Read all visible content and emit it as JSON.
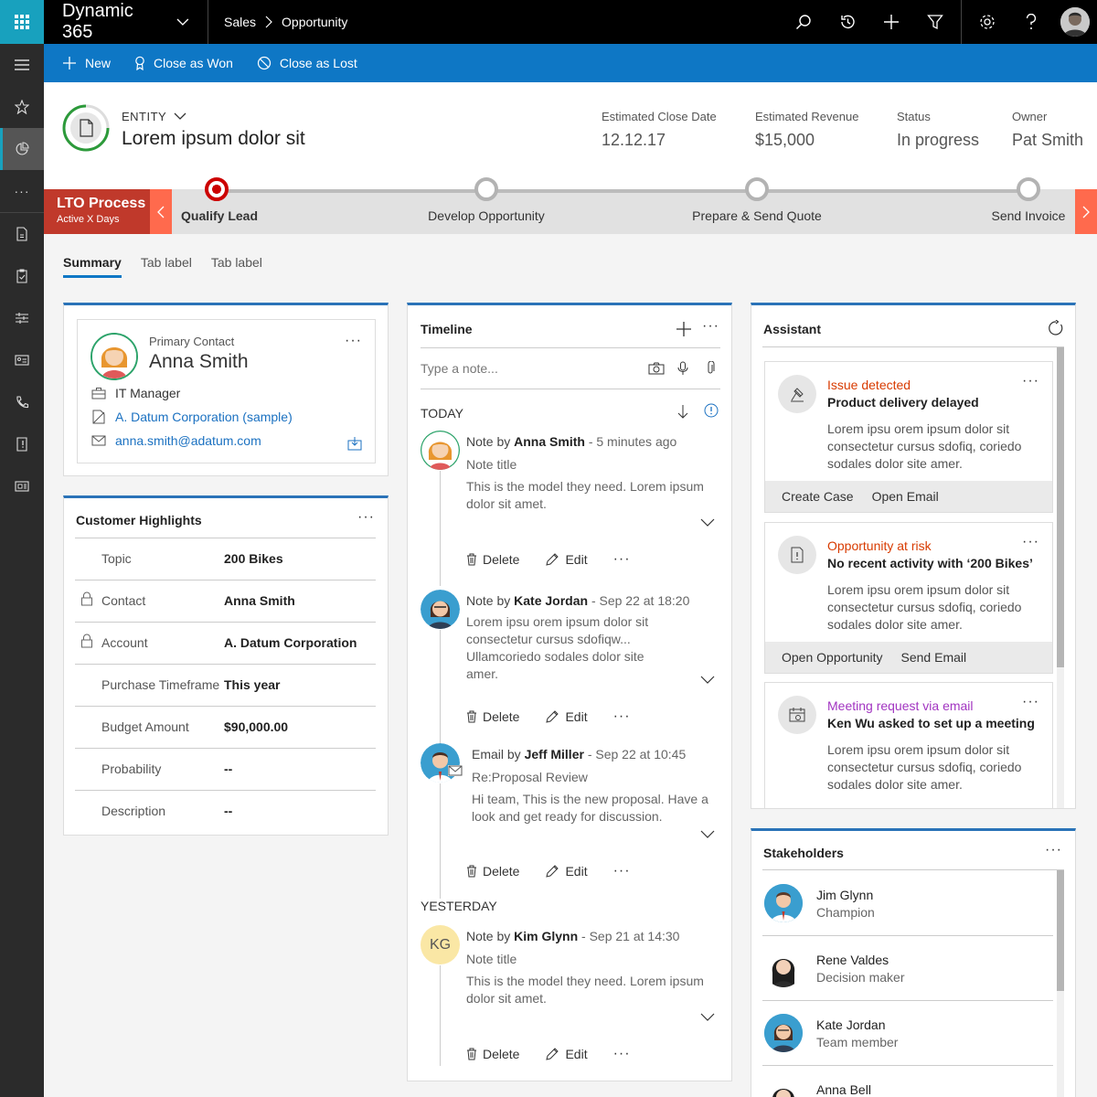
{
  "app": {
    "title": "Dynamic 365"
  },
  "breadcrumb": {
    "items": [
      "Sales",
      "Opportunity"
    ]
  },
  "command_bar": {
    "new_label": "New",
    "close_won_label": "Close as Won",
    "close_lost_label": "Close as Lost"
  },
  "header": {
    "entity_label": "ENTITY",
    "entity_title": "Lorem ipsum dolor sit",
    "fields": [
      {
        "label": "Estimated Close Date",
        "value": "12.12.17"
      },
      {
        "label": "Estimated Revenue",
        "value": "$15,000"
      },
      {
        "label": "Status",
        "value": "In progress"
      },
      {
        "label": "Owner",
        "value": "Pat Smith"
      }
    ]
  },
  "process": {
    "name": "LTO Process",
    "sub": "Active X Days",
    "stages": [
      "Qualify Lead",
      "Develop Opportunity",
      "Prepare & Send Quote",
      "Send Invoice"
    ],
    "active_stage": 0
  },
  "tabs": [
    "Summary",
    "Tab label",
    "Tab label"
  ],
  "primary_contact": {
    "label": "Primary Contact",
    "name": "Anna Smith",
    "job": "IT Manager",
    "company": "A. Datum Corporation (sample)",
    "email": "anna.smith@adatum.com"
  },
  "highlights": {
    "title": "Customer Highlights",
    "rows": [
      {
        "key": "Topic",
        "value": "200 Bikes",
        "locked": false
      },
      {
        "key": "Contact",
        "value": "Anna Smith",
        "locked": true
      },
      {
        "key": "Account",
        "value": "A. Datum Corporation",
        "locked": true
      },
      {
        "key": "Purchase Timeframe",
        "value": "This year",
        "locked": false
      },
      {
        "key": "Budget Amount",
        "value": "$90,000.00",
        "locked": false
      },
      {
        "key": "Probability",
        "value": "--",
        "locked": false
      },
      {
        "key": "Description",
        "value": "--",
        "locked": false
      }
    ]
  },
  "timeline": {
    "title": "Timeline",
    "placeholder": "Type a note...",
    "today_label": "TODAY",
    "yesterday_label": "YESTERDAY",
    "delete_label": "Delete",
    "edit_label": "Edit",
    "entries": [
      {
        "kind": "Note by",
        "author": "Anna Smith",
        "when": "- 5 minutes ago",
        "subtitle": "Note title",
        "body": "This is the model they need. Lorem ipsum dolor sit amet."
      },
      {
        "kind": "Note by",
        "author": "Kate Jordan",
        "when": "- Sep 22 at 18:20",
        "subtitle": "",
        "body": "Lorem ipsu orem ipsum dolor sit consectetur cursus sdofiqw... Ullamcoriedo sodales dolor site amer."
      },
      {
        "kind": "Email by",
        "author": "Jeff Miller",
        "when": "- Sep 22 at 10:45",
        "subtitle": "Re:Proposal Review",
        "body": "Hi team, This is the new proposal. Have a look and get ready for discussion."
      },
      {
        "kind": "Note by",
        "author": "Kim Glynn",
        "when": "- Sep 21 at 14:30",
        "subtitle": "Note title",
        "body": "This is the model they need. Lorem ipsum dolor sit amet.",
        "initials": "KG"
      }
    ]
  },
  "assistant": {
    "title": "Assistant",
    "cards": [
      {
        "type": "Issue detected",
        "type_color": "#d83b01",
        "title": "Product delivery delayed",
        "body": "Lorem ipsu orem ipsum dolor sit consectetur cursus sdofiq, coriedo sodales dolor site amer.",
        "actions": [
          "Create Case",
          "Open Email"
        ]
      },
      {
        "type": "Opportunity at risk",
        "type_color": "#d83b01",
        "title": "No recent activity with ‘200 Bikes’",
        "body": "Lorem ipsu orem ipsum dolor sit consectetur cursus sdofiq, coriedo sodales dolor site amer.",
        "actions": [
          "Open Opportunity",
          "Send Email"
        ]
      },
      {
        "type": "Meeting request via email",
        "type_color": "#a235c1",
        "title": "Ken Wu asked to set up a meeting",
        "body": "Lorem ipsu orem ipsum dolor sit consectetur cursus sdofiq, coriedo sodales dolor site amer.",
        "actions": []
      }
    ]
  },
  "stakeholders": {
    "title": "Stakeholders",
    "people": [
      {
        "name": "Jim Glynn",
        "role": "Champion"
      },
      {
        "name": "Rene Valdes",
        "role": "Decision maker"
      },
      {
        "name": "Kate Jordan",
        "role": "Team member"
      },
      {
        "name": "Anna Bell",
        "role": ""
      }
    ]
  }
}
